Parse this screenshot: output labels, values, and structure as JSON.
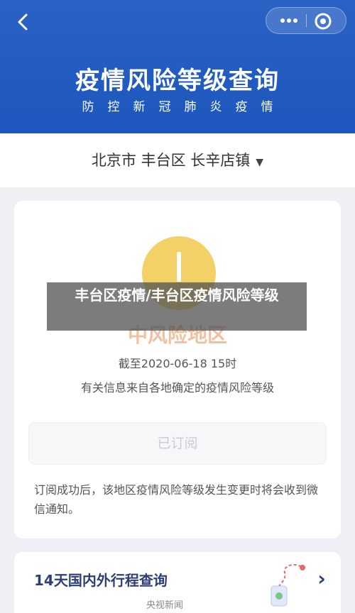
{
  "header": {
    "back_icon": "chevron-left-icon",
    "more_icon": "more-dots-icon",
    "close_icon": "target-circle-icon",
    "title": "疫情风险等级查询",
    "subtitle": "防控新冠肺炎疫情"
  },
  "location": {
    "text": "北京市 丰台区 长辛店镇",
    "caret": "▼"
  },
  "card": {
    "risk_level": "中风险地区",
    "timestamp": "截至2020-06-18 15时",
    "source_note": "有关信息来自各地确定的疫情风险等级",
    "subscribe_label": "已订阅",
    "notice": "订阅成功后，该地区疫情风险等级发生变更时将会收到微信通知。"
  },
  "trip": {
    "label": "14天国内外行程查询",
    "arrow": "›"
  },
  "watermark": "央视新闻",
  "overlay": {
    "caption": "丰台区疫情/丰台区疫情风险等级"
  },
  "colors": {
    "header_blue": "#1d57bd",
    "risk_yellow": "#f2c94c",
    "trip_text": "#2d3f77"
  }
}
